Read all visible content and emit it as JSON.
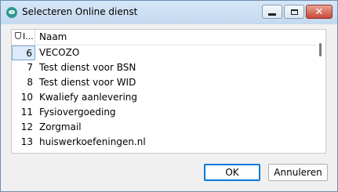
{
  "window": {
    "title": "Selecteren Online dienst"
  },
  "titlebar": {
    "close_glyph": "✕"
  },
  "list": {
    "columns": {
      "num": "I...",
      "name": "Naam"
    },
    "rows": [
      {
        "num": "6",
        "name": "VECOZO"
      },
      {
        "num": "7",
        "name": "Test dienst voor BSN"
      },
      {
        "num": "8",
        "name": "Test dienst voor WID"
      },
      {
        "num": "10",
        "name": "Kwaliefy aanlevering"
      },
      {
        "num": "11",
        "name": "Fysiovergoeding"
      },
      {
        "num": "12",
        "name": "Zorgmail"
      },
      {
        "num": "13",
        "name": "huiswerkoefeningen.nl"
      }
    ],
    "selected_index": 0
  },
  "buttons": {
    "ok": "OK",
    "cancel": "Annuleren"
  },
  "colors": {
    "selection": "#dceaf9",
    "ok_border": "#0078d7"
  },
  "icons": {
    "app": "online-service-icon",
    "column": "lock-icon"
  }
}
